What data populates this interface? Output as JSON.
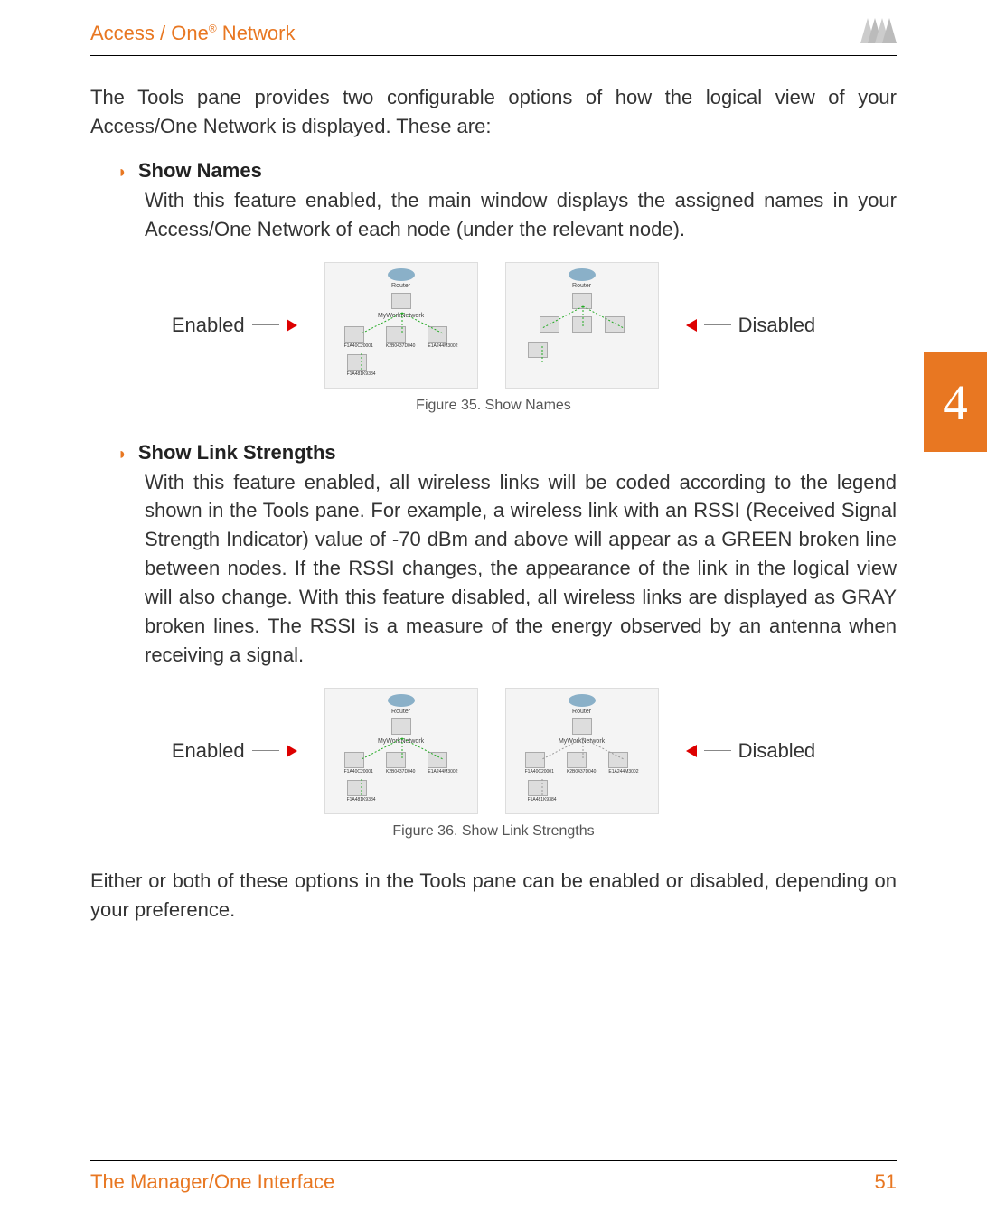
{
  "header": {
    "title_prefix": "Access / One",
    "title_reg": "®",
    "title_suffix": " Network"
  },
  "intro": "The Tools pane provides two configurable options of how the logical view of your Access/One Network is displayed. These are:",
  "bullets": {
    "showNames": {
      "title": "Show Names",
      "body": "With this feature enabled, the main window displays the assigned names in your Access/One Network of each node (under the relevant node)."
    },
    "showLinks": {
      "title": "Show Link Strengths",
      "body": "With this feature enabled, all wireless links will be coded according to the legend shown in the Tools pane. For example, a wireless link with an RSSI (Received Signal Strength Indicator) value of -70 dBm and above will appear as a GREEN broken line between nodes. If the RSSI changes, the appearance of the link in the logical view will also change. With this feature disabled, all wireless links are displayed as GRAY broken lines. The RSSI is a measure of the energy observed by an antenna when receiving a signal."
    }
  },
  "labels": {
    "enabled": "Enabled",
    "disabled": "Disabled"
  },
  "topo": {
    "routerLabel": "Router",
    "networkLabel": "MyWorkNetwork",
    "leaf1": "F1A40C20001",
    "leaf2": "K2B0437D040",
    "leaf3": "E1A244M3002",
    "leaf4": "F1A481K9384"
  },
  "captions": {
    "fig35": "Figure 35. Show Names",
    "fig36": "Figure 36. Show Link Strengths"
  },
  "outro": "Either or both of these options in the Tools pane can be enabled or disabled, depending on your preference.",
  "sideTab": "4",
  "footer": {
    "left": "The Manager/One Interface",
    "right": "51"
  }
}
